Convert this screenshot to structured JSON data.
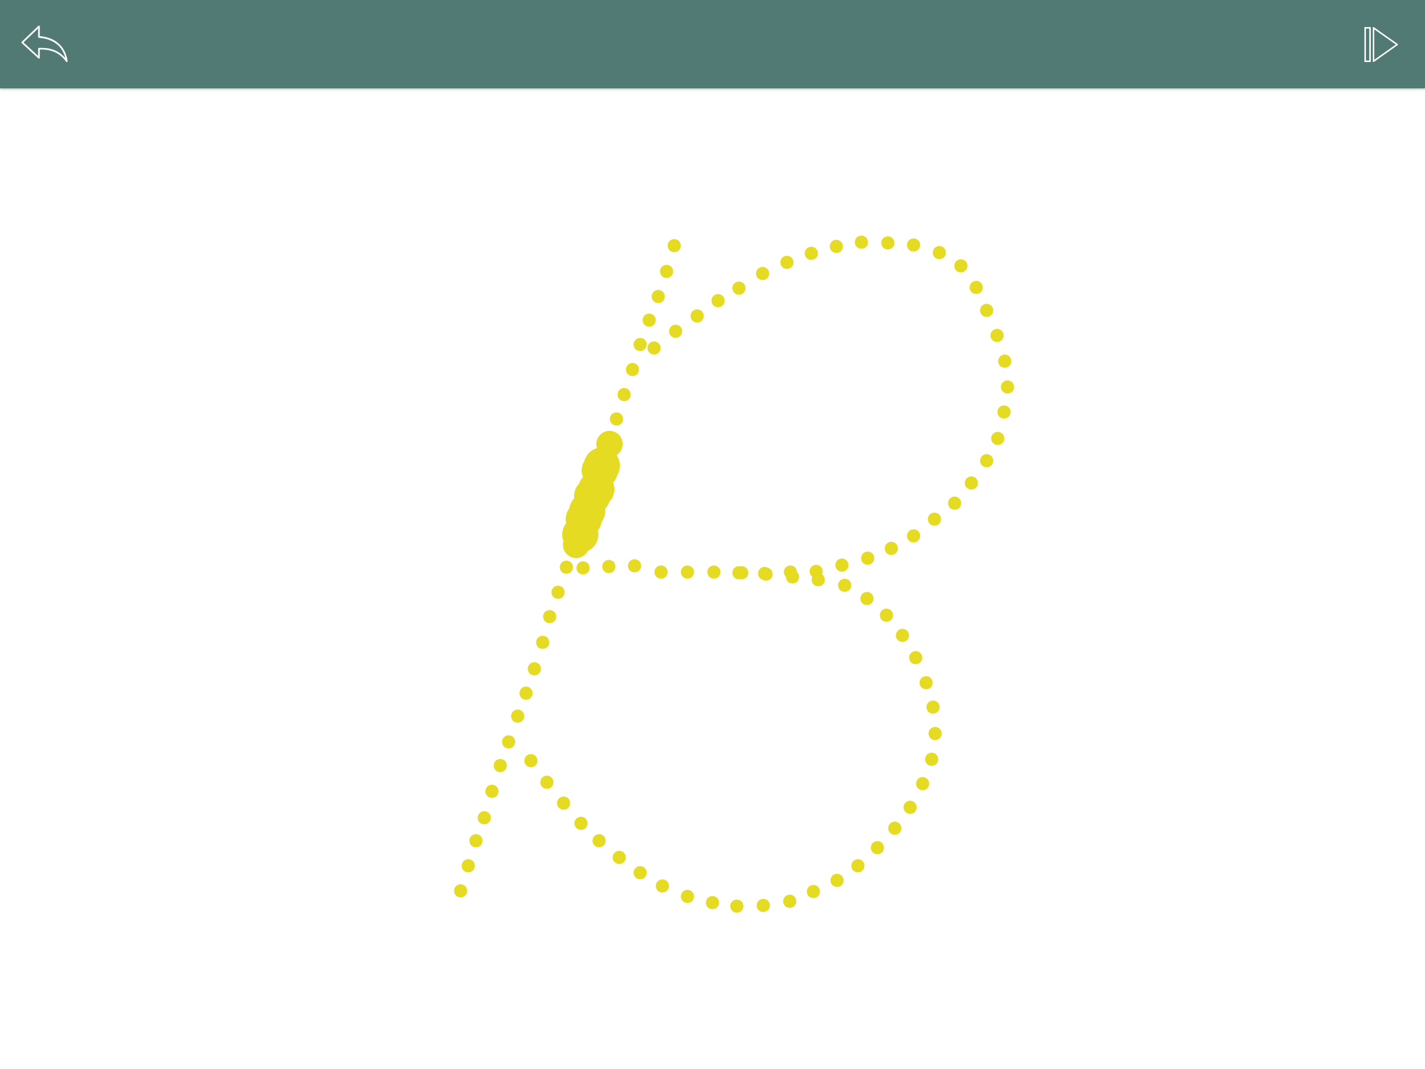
{
  "app": {
    "bar_color": "#507a73",
    "icon_color": "#ffffff",
    "stroke_color": "#e6db23",
    "letter": "B"
  },
  "toolbar": {
    "back_icon": "reply-arrow-icon",
    "next_icon": "skip-forward-icon"
  }
}
